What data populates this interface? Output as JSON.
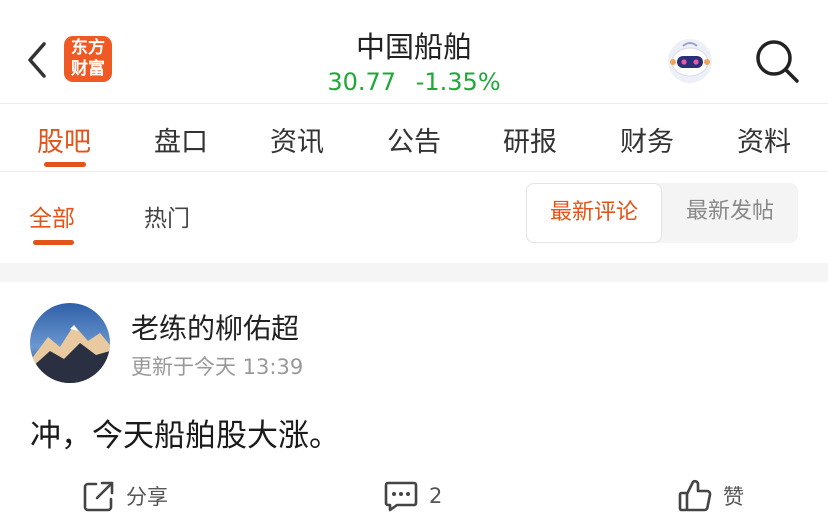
{
  "header": {
    "logo_line1": "东方",
    "logo_line2": "财富",
    "stock_name": "中国船舶",
    "price": "30.77",
    "change": "-1.35%",
    "quote_color": "#1ea838",
    "accent_color": "#e2541a"
  },
  "tabs": [
    {
      "label": "股吧",
      "active": true
    },
    {
      "label": "盘口"
    },
    {
      "label": "资讯"
    },
    {
      "label": "公告"
    },
    {
      "label": "研报"
    },
    {
      "label": "财务"
    },
    {
      "label": "资料"
    }
  ],
  "subtabs": {
    "all": "全部",
    "hot": "热门",
    "sort_latest_comment": "最新评论",
    "sort_latest_post": "最新发帖",
    "selected_sort": "最新评论"
  },
  "post": {
    "author": "老练的柳佑超",
    "time": "更新于今天 13:39",
    "content": "冲，今天船舶股大涨。",
    "share_label": "分享",
    "comment_count": "2",
    "like_label": "赞"
  }
}
